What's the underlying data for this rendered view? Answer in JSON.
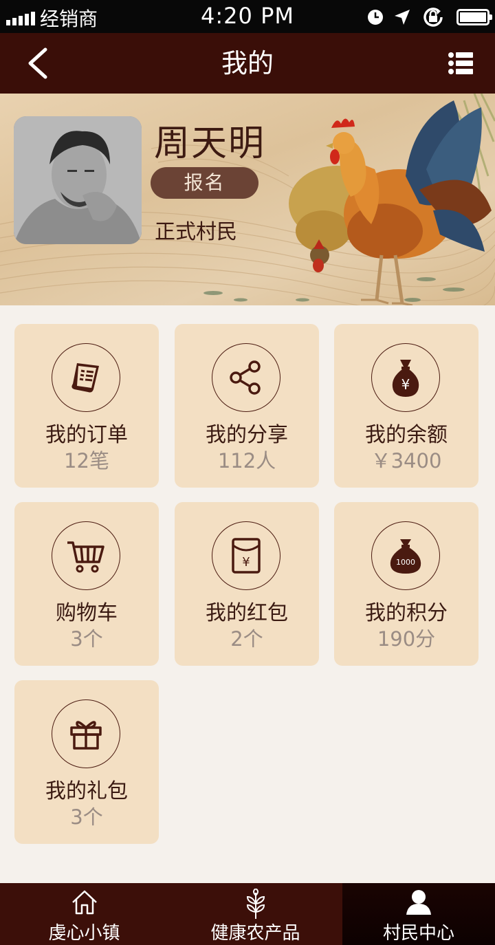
{
  "status_bar": {
    "carrier": "经销商",
    "time": "4:20 PM"
  },
  "nav": {
    "title": "我的"
  },
  "profile": {
    "name": "周天明",
    "signup_label": "报名",
    "role": "正式村民"
  },
  "cards": [
    {
      "label": "我的订单",
      "value": "12笔",
      "icon": "receipt-icon"
    },
    {
      "label": "我的分享",
      "value": "112人",
      "icon": "share-icon"
    },
    {
      "label": "我的余额",
      "value": "￥3400",
      "icon": "money-bag-icon"
    },
    {
      "label": "购物车",
      "value": "3个",
      "icon": "cart-icon"
    },
    {
      "label": "我的红包",
      "value": "2个",
      "icon": "red-envelope-icon"
    },
    {
      "label": "我的积分",
      "value": "190分",
      "icon": "points-bag-icon",
      "badge": "1000"
    },
    {
      "label": "我的礼包",
      "value": "3个",
      "icon": "gift-icon"
    }
  ],
  "tabs": [
    {
      "label": "虔心小镇",
      "icon": "home-icon",
      "active": false
    },
    {
      "label": "健康农产品",
      "icon": "wheat-icon",
      "active": false
    },
    {
      "label": "村民中心",
      "icon": "user-icon",
      "active": true
    }
  ],
  "colors": {
    "nav_bg": "#3a0e08",
    "card_bg": "#f3dfc3",
    "accent": "#4a1a10",
    "page_bg": "#f5f1ec"
  }
}
